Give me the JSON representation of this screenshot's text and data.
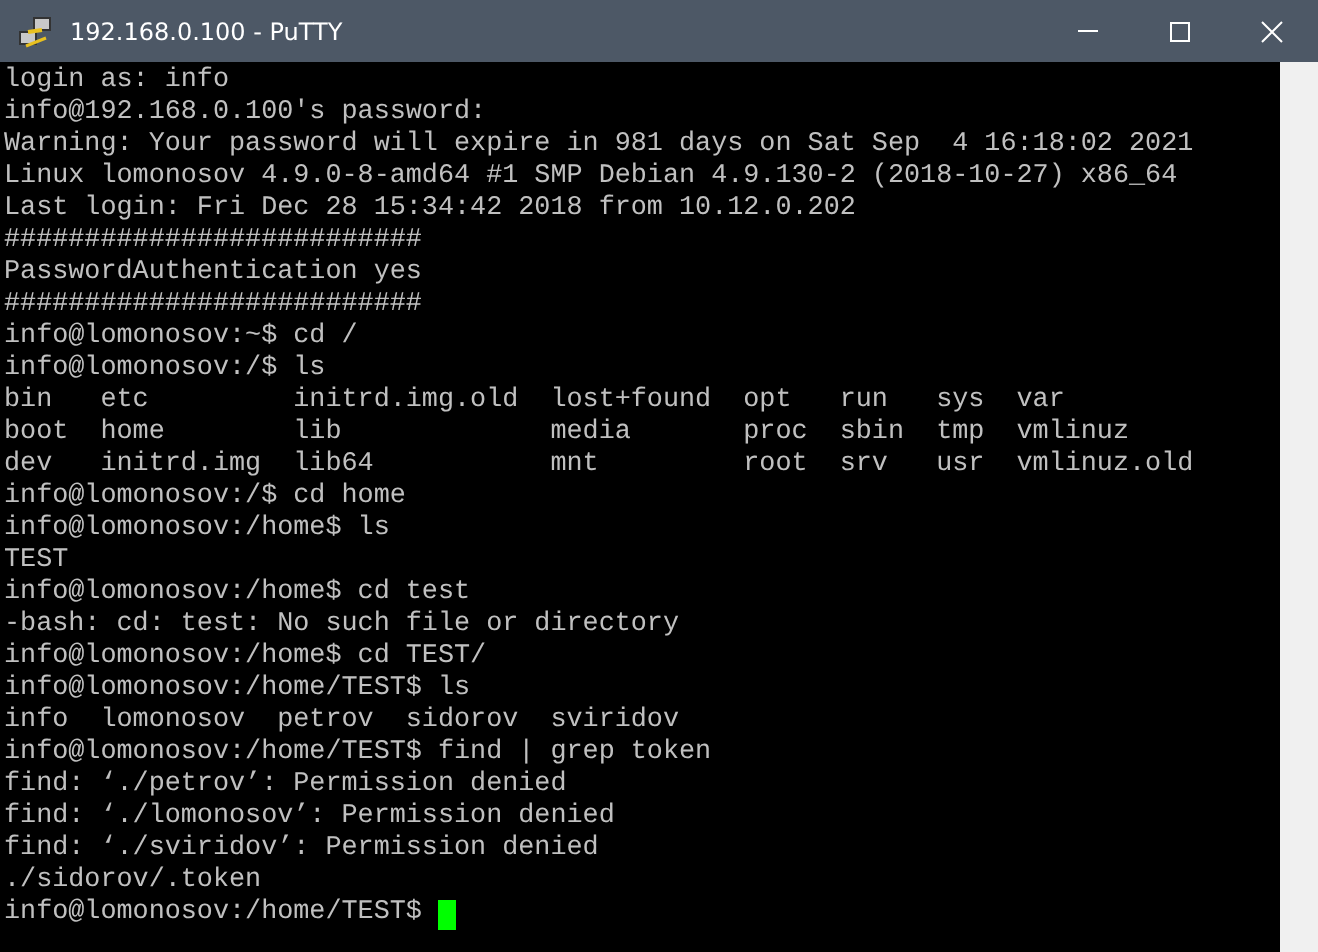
{
  "window": {
    "title": "192.168.0.100 - PuTTY"
  },
  "terminal": {
    "lines": [
      "login as: info",
      "info@192.168.0.100's password:",
      "Warning: Your password will expire in 981 days on Sat Sep  4 16:18:02 2021",
      "Linux lomonosov 4.9.0-8-amd64 #1 SMP Debian 4.9.130-2 (2018-10-27) x86_64",
      "Last login: Fri Dec 28 15:34:42 2018 from 10.12.0.202",
      "##########################",
      "PasswordAuthentication yes",
      "##########################",
      "info@lomonosov:~$ cd /",
      "info@lomonosov:/$ ls",
      "bin   etc         initrd.img.old  lost+found  opt   run   sys  var",
      "boot  home        lib             media       proc  sbin  tmp  vmlinuz",
      "dev   initrd.img  lib64           mnt         root  srv   usr  vmlinuz.old",
      "info@lomonosov:/$ cd home",
      "info@lomonosov:/home$ ls",
      "TEST",
      "info@lomonosov:/home$ cd test",
      "-bash: cd: test: No such file or directory",
      "info@lomonosov:/home$ cd TEST/",
      "info@lomonosov:/home/TEST$ ls",
      "info  lomonosov  petrov  sidorov  sviridov",
      "info@lomonosov:/home/TEST$ find | grep token",
      "find: ‘./petrov’: Permission denied",
      "find: ‘./lomonosov’: Permission denied",
      "find: ‘./sviridov’: Permission denied",
      "./sidorov/.token",
      "info@lomonosov:/home/TEST$ "
    ]
  }
}
